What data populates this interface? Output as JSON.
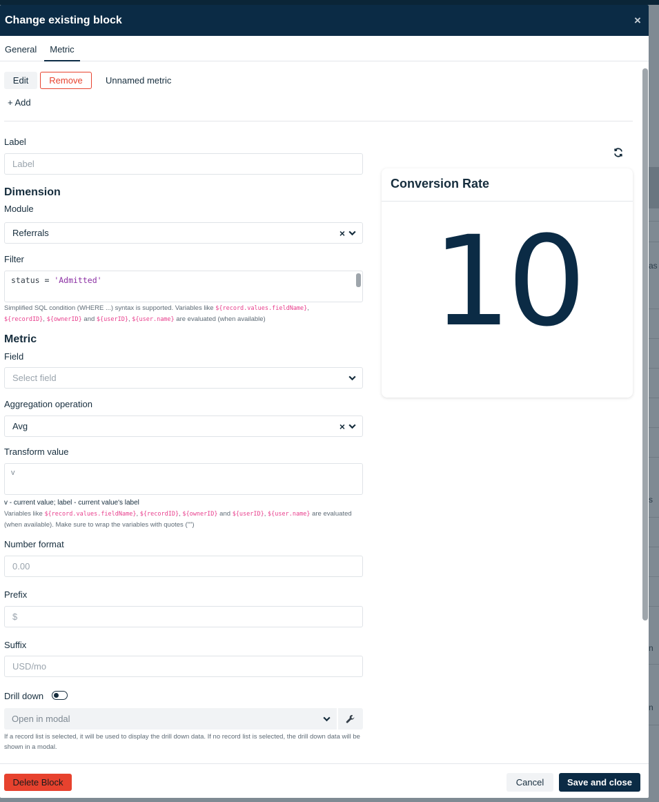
{
  "modal": {
    "title": "Change existing block",
    "close_glyph": "×",
    "tabs": [
      {
        "label": "General"
      },
      {
        "label": "Metric"
      }
    ],
    "active_tab": "Metric"
  },
  "metrics_bar": {
    "edit_label": "Edit",
    "remove_label": "Remove",
    "metric_name": "Unnamed metric",
    "add_label": "+ Add"
  },
  "form": {
    "label": {
      "title": "Label",
      "placeholder": "Label",
      "value": ""
    },
    "dimension_heading": "Dimension",
    "module": {
      "title": "Module",
      "value": "Referrals"
    },
    "filter": {
      "title": "Filter",
      "code_key": "status = ",
      "code_value": "'Admitted'",
      "hint_prefix": "Simplified SQL condition (WHERE ...) syntax is supported. Variables like ",
      "hint_var1": "${record.values.fieldName}",
      "hint_sep1": ",",
      "hint_var2": "${recordID}",
      "hint_sep2": ", ",
      "hint_var3": "${ownerID}",
      "hint_and": " and ",
      "hint_var4": "${userID}",
      "hint_sep3": ", ",
      "hint_var5": "${user.name}",
      "hint_suffix": " are evaluated (when available)"
    },
    "metric_heading": "Metric",
    "field": {
      "title": "Field",
      "placeholder": "Select field"
    },
    "aggregation": {
      "title": "Aggregation operation",
      "value": "Avg"
    },
    "transform": {
      "title": "Transform value",
      "value": "v",
      "hint_line1": "v - current value; label - current value's label",
      "hint_prefix": "Variables like ",
      "hint_var1": "${record.values.fieldName}",
      "hint_sep1": ", ",
      "hint_var2": "${recordID}",
      "hint_sep2": ", ",
      "hint_var3": "${ownerID}",
      "hint_and": " and ",
      "hint_var4": "${userID}",
      "hint_sep3": ", ",
      "hint_var5": "${user.name}",
      "hint_suffix": " are evaluated (when available). Make sure to wrap the variables with quotes (\"\")"
    },
    "number_format": {
      "title": "Number format",
      "placeholder": "0.00"
    },
    "prefix": {
      "title": "Prefix",
      "placeholder": "$"
    },
    "suffix": {
      "title": "Suffix",
      "placeholder": "USD/mo"
    },
    "drill_down": {
      "title": "Drill down",
      "enabled": false,
      "select_value": "Open in modal",
      "hint": "If a record list is selected, it will be used to display the drill down data. If no record list is selected, the drill down data will be shown in a modal."
    }
  },
  "preview": {
    "title": "Conversion Rate",
    "value": "10"
  },
  "footer": {
    "delete_label": "Delete Block",
    "cancel_label": "Cancel",
    "save_label": "Save and close"
  },
  "background": {
    "fragments": [
      "as",
      "s",
      "n",
      "n"
    ]
  },
  "colors": {
    "header_bg": "#0b2b45",
    "danger": "#e7422e",
    "primary": "#0b2b45",
    "code_pink": "#e83e8c"
  },
  "icons": [
    "close-icon",
    "chevron-down-icon",
    "clear-icon",
    "refresh-icon",
    "wrench-icon"
  ]
}
